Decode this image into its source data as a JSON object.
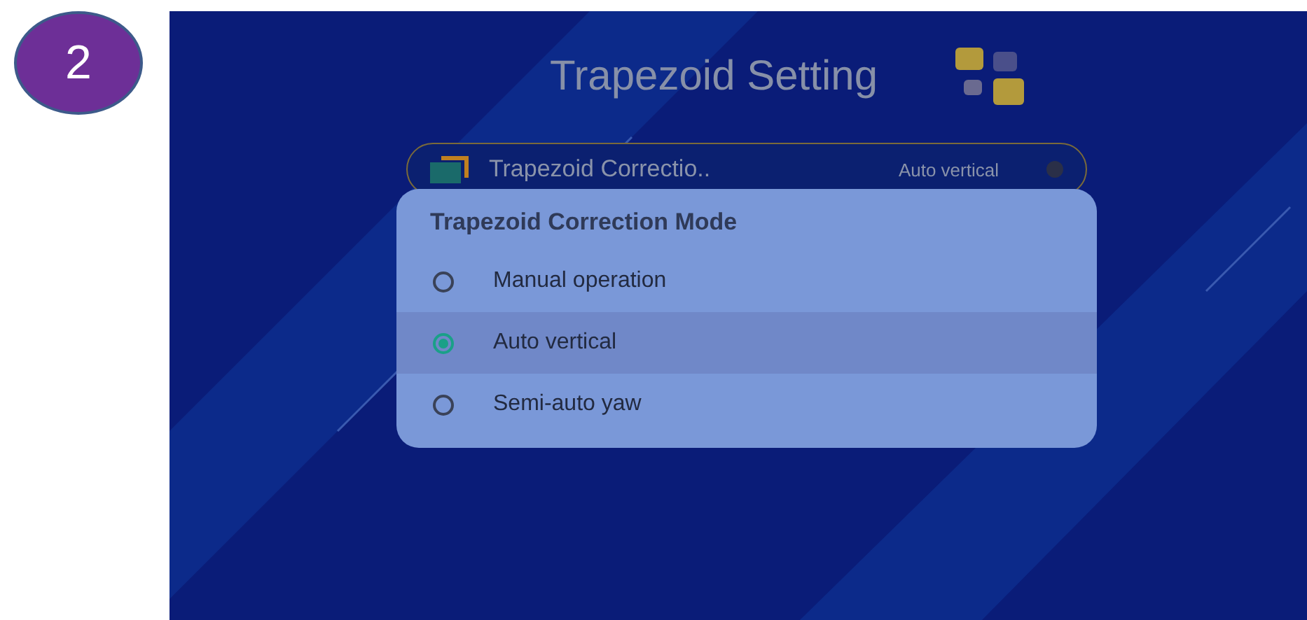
{
  "step_badge": "2",
  "screen": {
    "title": "Trapezoid Setting",
    "setting_row": {
      "label": "Trapezoid Correctio..",
      "value": "Auto vertical"
    },
    "dialog": {
      "title": "Trapezoid Correction Mode",
      "options": [
        {
          "label": "Manual operation",
          "selected": false
        },
        {
          "label": "Auto vertical",
          "selected": true
        },
        {
          "label": "Semi-auto yaw",
          "selected": false
        }
      ]
    }
  }
}
